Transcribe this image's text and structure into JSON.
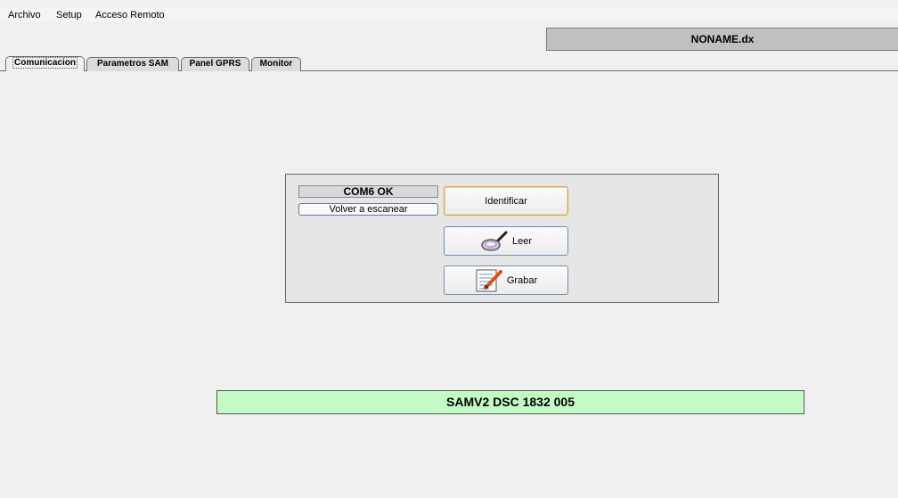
{
  "menu": {
    "archivo": "Archivo",
    "setup": "Setup",
    "acceso_remoto": "Acceso Remoto"
  },
  "filename": "NONAME.dx",
  "tabs": [
    {
      "label": "Comunicacion",
      "active": true
    },
    {
      "label": "Parametros SAM",
      "active": false
    },
    {
      "label": "Panel GPRS",
      "active": false
    },
    {
      "label": "Monitor",
      "active": false
    }
  ],
  "comm": {
    "port_status": "COM6 OK",
    "rescan_label": "Volver a escanear",
    "identify_label": "Identificar",
    "read_label": "Leer",
    "write_label": "Grabar"
  },
  "device_id": "SAMV2 DSC 1832 005",
  "colors": {
    "background": "#f0f0f0",
    "device_bar": "#c4fbc4",
    "filename_bar": "#c0c0c0",
    "identify_border": "#d9a14a"
  },
  "icons": {
    "read": "magnifier-icon",
    "write": "notepad-pencil-icon"
  }
}
